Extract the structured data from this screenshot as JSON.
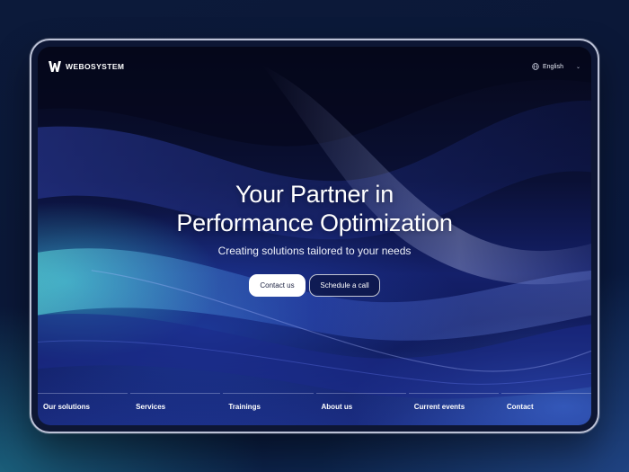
{
  "brand": {
    "name": "WEBOSYSTEM",
    "icon": "logo-w-icon"
  },
  "language": {
    "label": "English",
    "icon": "globe-icon",
    "chevron": "chevron-down-icon"
  },
  "hero": {
    "title_line1": "Your Partner in",
    "title_line2": "Performance Optimization",
    "subtitle": "Creating solutions tailored to your needs"
  },
  "buttons": {
    "primary": "Contact us",
    "secondary": "Schedule a call"
  },
  "nav": [
    "Our solutions",
    "Services",
    "Trainings",
    "About us",
    "Current events",
    "Contact"
  ],
  "colors": {
    "background": "#0b1838",
    "accent_teal": "#3cd2d2",
    "accent_blue": "#2a50d0",
    "text": "#ffffff"
  }
}
